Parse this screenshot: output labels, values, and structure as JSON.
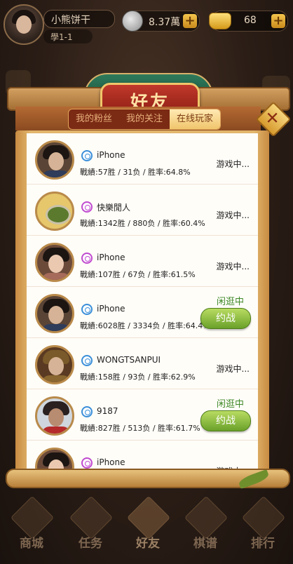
{
  "header": {
    "username": "小熊饼干",
    "level": "學1-1",
    "coins": "8.37萬",
    "gold": "68",
    "plus": "+"
  },
  "panel": {
    "title": "好友",
    "tabs": [
      {
        "label": "我的粉丝",
        "active": false
      },
      {
        "label": "我的关注",
        "active": false
      },
      {
        "label": "在线玩家",
        "active": true
      }
    ],
    "close": "✕"
  },
  "players": [
    {
      "name": "iPhone",
      "gender": "male",
      "stats": "戰績:57胜 / 31负 / 胜率:64.8%",
      "status": "游戏中...",
      "idle": "",
      "invite": ""
    },
    {
      "name": "快樂閒人",
      "gender": "female",
      "stats": "戰績:1342胜 / 880负 / 胜率:60.4%",
      "status": "游戏中...",
      "idle": "",
      "invite": ""
    },
    {
      "name": "iPhone",
      "gender": "female",
      "stats": "戰績:107胜 / 67负 / 胜率:61.5%",
      "status": "游戏中...",
      "idle": "",
      "invite": ""
    },
    {
      "name": "iPhone",
      "gender": "male",
      "stats": "戰績:6028胜 / 3334负 / 胜率:64.4%",
      "status": "",
      "idle": "闲逛中",
      "invite": "约战"
    },
    {
      "name": "WONGTSANPUI",
      "gender": "male",
      "stats": "戰績:158胜 / 93负 / 胜率:62.9%",
      "status": "游戏中...",
      "idle": "",
      "invite": ""
    },
    {
      "name": "9187",
      "gender": "male",
      "stats": "戰績:827胜 / 513负 / 胜率:61.7%",
      "status": "",
      "idle": "闲逛中",
      "invite": "约战"
    },
    {
      "name": "iPhone",
      "gender": "female",
      "stats": "",
      "status": "游戏中...",
      "idle": "",
      "invite": ""
    }
  ],
  "nav": [
    {
      "label": "商城"
    },
    {
      "label": "任务"
    },
    {
      "label": "好友",
      "active": true
    },
    {
      "label": "棋谱"
    },
    {
      "label": "排行"
    }
  ]
}
